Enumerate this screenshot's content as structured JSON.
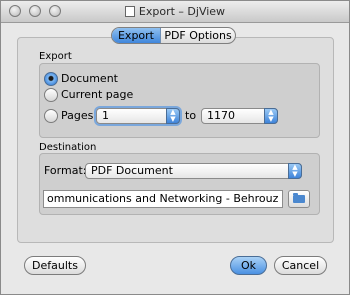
{
  "window": {
    "title": "Export – DjView"
  },
  "tabs": [
    {
      "label": "Export"
    },
    {
      "label": "PDF Options"
    }
  ],
  "export_group": {
    "label": "Export",
    "options": [
      {
        "label": "Document",
        "selected": true
      },
      {
        "label": "Current page",
        "selected": false
      },
      {
        "label": "Pages",
        "selected": false
      }
    ],
    "from_page": "1",
    "to_label": "to",
    "to_page": "1170"
  },
  "destination_group": {
    "label": "Destination",
    "format_label": "Format:",
    "format_value": "PDF Document",
    "file_path": "ommunications and Networking - Behrouz A.pdf"
  },
  "buttons": {
    "defaults": "Defaults",
    "ok": "Ok",
    "cancel": "Cancel"
  },
  "colors": {
    "accent": "#3f86dc"
  }
}
